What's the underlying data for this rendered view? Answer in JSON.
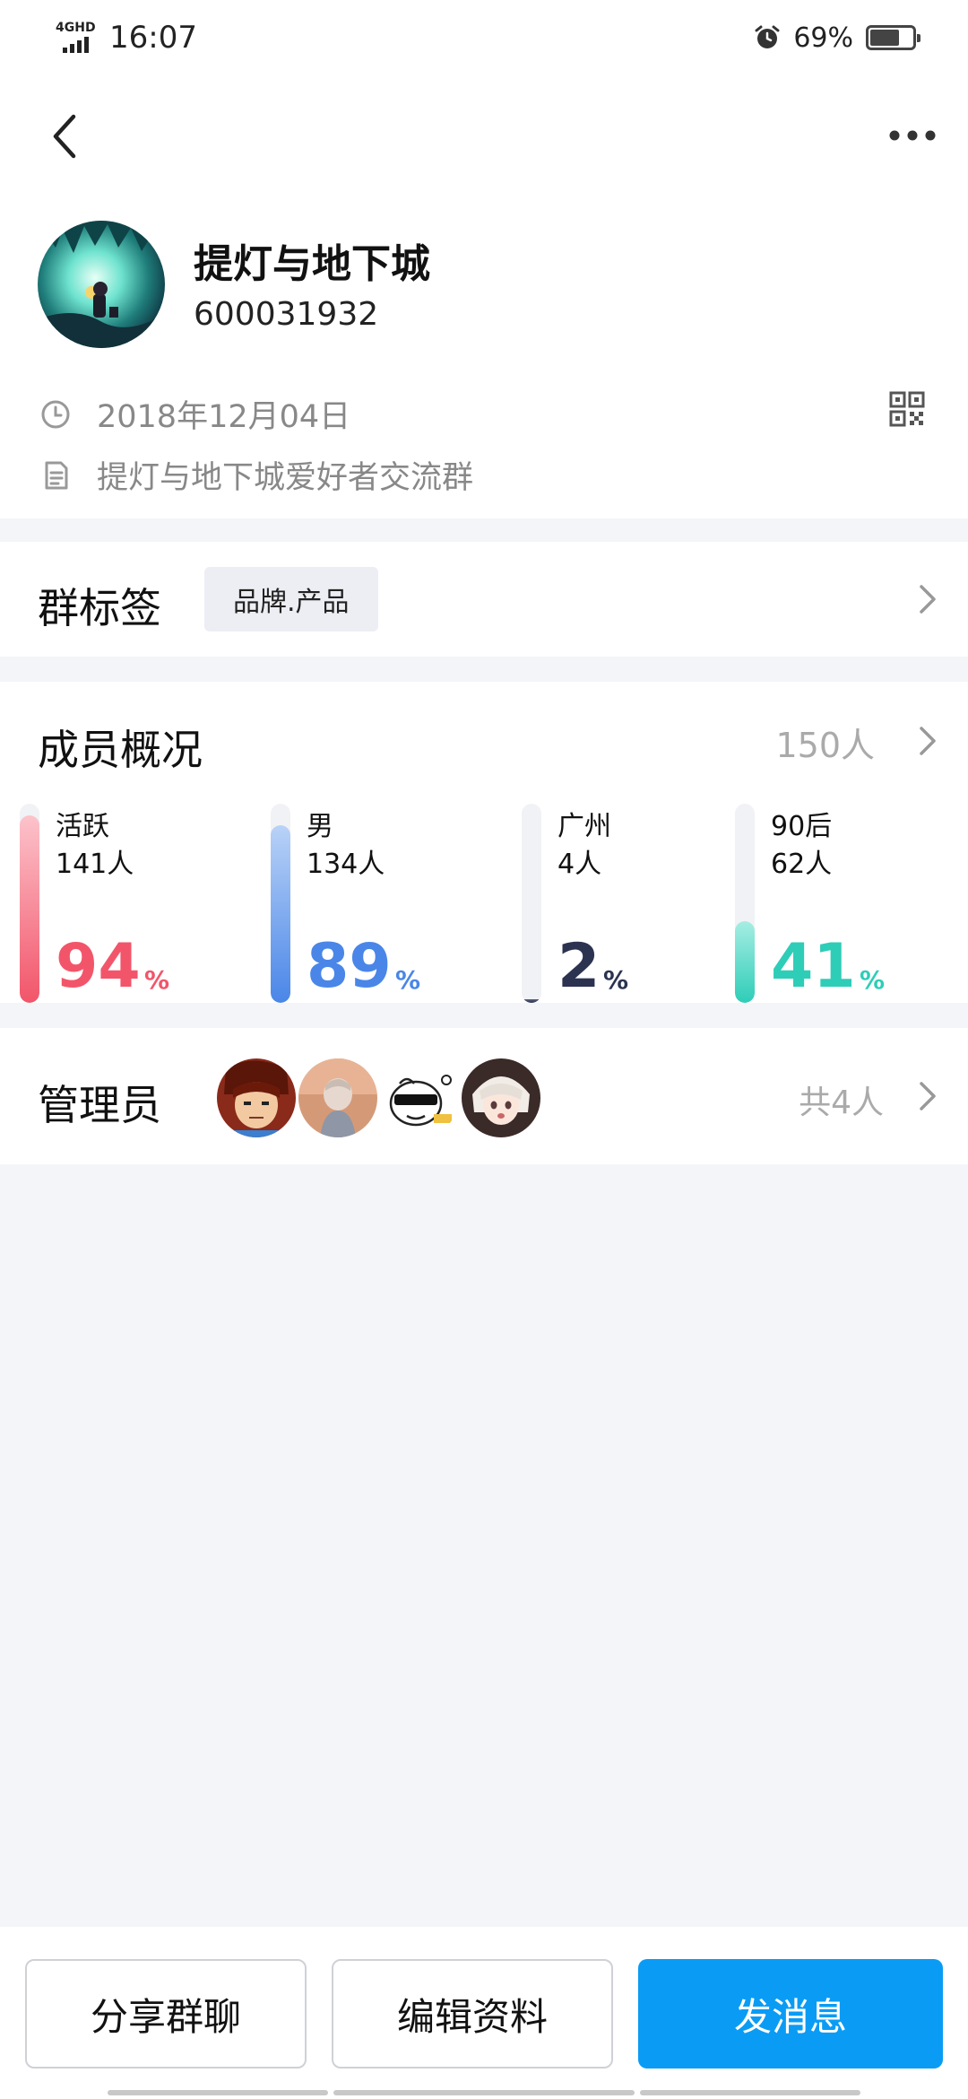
{
  "status_bar": {
    "network": "4GHD",
    "time": "16:07",
    "battery_percent": "69%",
    "battery_level": 0.69
  },
  "group": {
    "name": "提灯与地下城",
    "id": "600031932",
    "created_date": "2018年12月04日",
    "description": "提灯与地下城爱好者交流群"
  },
  "tags": {
    "title": "群标签",
    "items": [
      "品牌.产品"
    ]
  },
  "members": {
    "title": "成员概况",
    "count": "150人",
    "stats": [
      {
        "label": "活跃",
        "count": "141人",
        "percent": "94",
        "unit": "%",
        "value": 0.94,
        "color": "#f2556a",
        "bar_top": "#fcc3cb"
      },
      {
        "label": "男",
        "count": "134人",
        "percent": "89",
        "unit": "%",
        "value": 0.89,
        "color": "#4a86e8",
        "bar_top": "#b9d2f7"
      },
      {
        "label": "广州",
        "count": "4人",
        "percent": "2",
        "unit": "%",
        "value": 0.02,
        "color": "#2b3350",
        "bar_top": "#5a6080"
      },
      {
        "label": "90后",
        "count": "62人",
        "percent": "41",
        "unit": "%",
        "value": 0.41,
        "color": "#2ecdb8",
        "bar_top": "#a6ede3"
      }
    ]
  },
  "admins": {
    "title": "管理员",
    "total": "共4人"
  },
  "actions": {
    "share": "分享群聊",
    "edit": "编辑资料",
    "send": "发消息"
  },
  "colors": {
    "primary": "#0a9cf5",
    "muted_text": "#888888",
    "page_bg": "#f4f5f8"
  }
}
